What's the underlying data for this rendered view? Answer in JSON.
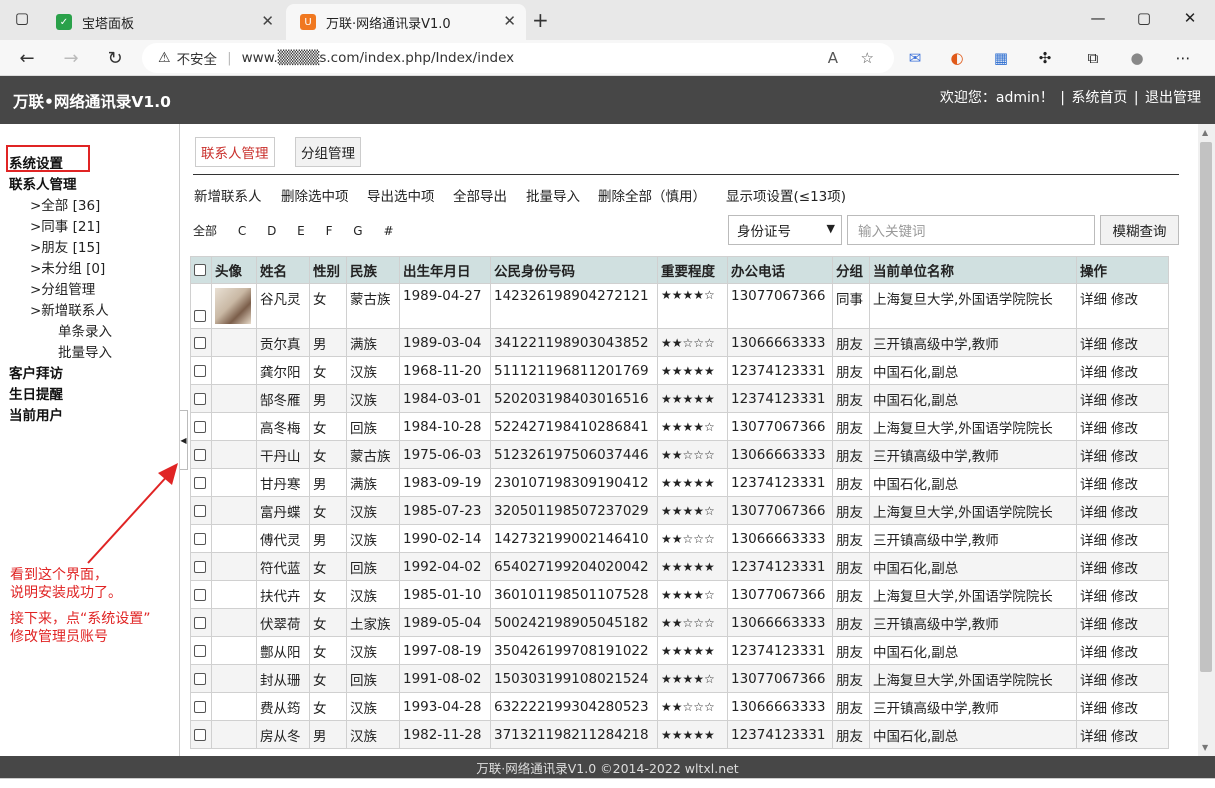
{
  "browser": {
    "tab1_title": "宝塔面板",
    "tab2_title": "万联·网络通讯录V1.0",
    "insecure": "不安全",
    "url": "www.▒▒▒▒s.com/index.php/Index/index"
  },
  "header": {
    "logo": "万联•网络通讯录V1.0",
    "welcome": "欢迎您：admin！",
    "home": "系统首页",
    "logout": "退出管理",
    "sep": "|"
  },
  "sidebar": {
    "system": "系统设置",
    "contacts": "联系人管理",
    "all": ">全部 [36]",
    "colleague": ">同事 [21]",
    "friend": ">朋友 [15]",
    "ungrouped": ">未分组 [0]",
    "group_mgmt": ">分组管理",
    "add": ">新增联系人",
    "single": "单条录入",
    "batch": "批量导入",
    "visit": "客户拜访",
    "birthday": "生日提醒",
    "current_user": "当前用户"
  },
  "annotation": {
    "line1": "看到这个界面，",
    "line2": "说明安装成功了。",
    "line3": "接下来，点“系统设置”",
    "line4": "修改管理员账号"
  },
  "main": {
    "tab_contacts": "联系人管理",
    "tab_groups": "分组管理",
    "toolbar": {
      "new": "新增联系人",
      "delete_selected": "删除选中项",
      "export_selected": "导出选中项",
      "export_all": "全部导出",
      "batch_import": "批量导入",
      "delete_all": "删除全部（慎用）",
      "display_settings": "显示项设置(≤13项)"
    },
    "letters": [
      "全部",
      "C",
      "D",
      "E",
      "F",
      "G",
      "#"
    ],
    "search_field": "身份证号",
    "search_placeholder": "输入关键词",
    "search_button": "模糊查询"
  },
  "table": {
    "headers": [
      "头像",
      "姓名",
      "性别",
      "民族",
      "出生年月日",
      "公民身份号码",
      "重要程度",
      "办公电话",
      "分组",
      "当前单位名称",
      "操作"
    ],
    "op_detail": "详细",
    "op_edit": "修改",
    "rows": [
      [
        "谷凡灵",
        "女",
        "蒙古族",
        "1989-04-27",
        "142326198904272121",
        "★★★★☆",
        "13077067366",
        "同事",
        "上海复旦大学,外国语学院院长"
      ],
      [
        "贡尔真",
        "男",
        "满族",
        "1989-03-04",
        "341221198903043852",
        "★★☆☆☆",
        "13066663333",
        "朋友",
        "三开镇高级中学,教师"
      ],
      [
        "龚尔阳",
        "女",
        "汉族",
        "1968-11-20",
        "511121196811201769",
        "★★★★★",
        "12374123331",
        "朋友",
        "中国石化,副总"
      ],
      [
        "郜冬雁",
        "男",
        "汉族",
        "1984-03-01",
        "520203198403016516",
        "★★★★★",
        "12374123331",
        "朋友",
        "中国石化,副总"
      ],
      [
        "高冬梅",
        "女",
        "回族",
        "1984-10-28",
        "522427198410286841",
        "★★★★☆",
        "13077067366",
        "朋友",
        "上海复旦大学,外国语学院院长"
      ],
      [
        "干丹山",
        "女",
        "蒙古族",
        "1975-06-03",
        "512326197506037446",
        "★★☆☆☆",
        "13066663333",
        "朋友",
        "三开镇高级中学,教师"
      ],
      [
        "甘丹寒",
        "男",
        "满族",
        "1983-09-19",
        "230107198309190412",
        "★★★★★",
        "12374123331",
        "朋友",
        "中国石化,副总"
      ],
      [
        "富丹蝶",
        "女",
        "汉族",
        "1985-07-23",
        "320501198507237029",
        "★★★★☆",
        "13077067366",
        "朋友",
        "上海复旦大学,外国语学院院长"
      ],
      [
        "傅代灵",
        "男",
        "汉族",
        "1990-02-14",
        "142732199002146410",
        "★★☆☆☆",
        "13066663333",
        "朋友",
        "三开镇高级中学,教师"
      ],
      [
        "符代蓝",
        "女",
        "回族",
        "1992-04-02",
        "654027199204020042",
        "★★★★★",
        "12374123331",
        "朋友",
        "中国石化,副总"
      ],
      [
        "扶代卉",
        "女",
        "汉族",
        "1985-01-10",
        "360101198501107528",
        "★★★★☆",
        "13077067366",
        "朋友",
        "上海复旦大学,外国语学院院长"
      ],
      [
        "伏翠荷",
        "女",
        "土家族",
        "1989-05-04",
        "500242198905045182",
        "★★☆☆☆",
        "13066663333",
        "朋友",
        "三开镇高级中学,教师"
      ],
      [
        "鄷从阳",
        "女",
        "汉族",
        "1997-08-19",
        "350426199708191022",
        "★★★★★",
        "12374123331",
        "朋友",
        "中国石化,副总"
      ],
      [
        "封从珊",
        "女",
        "回族",
        "1991-08-02",
        "150303199108021524",
        "★★★★☆",
        "13077067366",
        "朋友",
        "上海复旦大学,外国语学院院长"
      ],
      [
        "费从筠",
        "女",
        "汉族",
        "1993-04-28",
        "632222199304280523",
        "★★☆☆☆",
        "13066663333",
        "朋友",
        "三开镇高级中学,教师"
      ],
      [
        "房从冬",
        "男",
        "汉族",
        "1982-11-28",
        "371321198211284218",
        "★★★★★",
        "12374123331",
        "朋友",
        "中国石化,副总"
      ]
    ]
  },
  "footer": "万联·网络通讯录V1.0 ©2014-2022 wltxl.net"
}
